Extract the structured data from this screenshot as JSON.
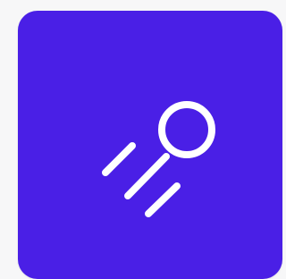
{
  "icon": {
    "name": "comet-icon",
    "background_color": "#4a1fe6",
    "foreground_color": "#ffffff",
    "page_background_color": "#f7f7f8"
  }
}
